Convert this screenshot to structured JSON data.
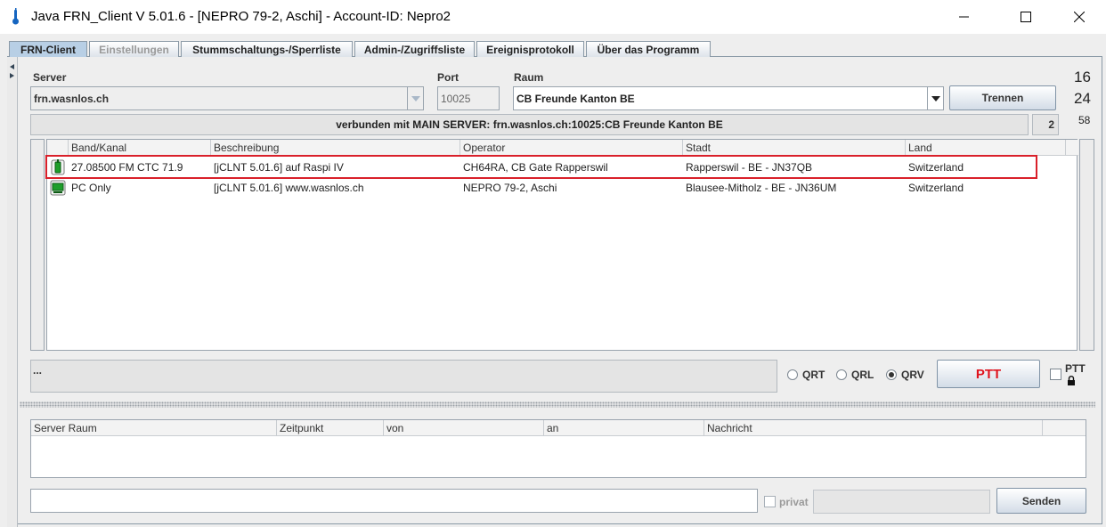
{
  "window": {
    "title": "Java FRN_Client V 5.01.6 - [NEPRO 79-2, Aschi] - Account-ID: Nepro2"
  },
  "tabs": [
    {
      "label": "FRN-Client",
      "state": "active"
    },
    {
      "label": "Einstellungen",
      "state": "disabled"
    },
    {
      "label": "Stummschaltungs-/Sperrliste",
      "state": "normal"
    },
    {
      "label": "Admin-/Zugriffsliste",
      "state": "normal"
    },
    {
      "label": "Ereignisprotokoll",
      "state": "normal"
    },
    {
      "label": "Über das Programm",
      "state": "normal"
    }
  ],
  "connection": {
    "server_label": "Server",
    "server_value": "frn.wasnlos.ch",
    "port_label": "Port",
    "port_value": "10025",
    "room_label": "Raum",
    "room_value": "CB Freunde Kanton BE",
    "disconnect_button": "Trennen",
    "status_text": "verbunden mit  MAIN SERVER: frn.wasnlos.ch:10025:CB Freunde Kanton BE",
    "counters": [
      "16",
      "24",
      "58"
    ],
    "user_count": "2"
  },
  "clients_table": {
    "headers": [
      "Band/Kanal",
      "Beschreibung",
      "Operator",
      "Stadt",
      "Land"
    ],
    "rows": [
      {
        "icon": "gateway-tx-icon",
        "band": "27.08500 FM CTC 71.9",
        "description": "[jCLNT 5.01.6] auf Raspi IV",
        "operator": "CH64RA, CB Gate Rapperswil",
        "city": "Rapperswil - BE - JN37QB",
        "country": "Switzerland",
        "highlighted": true
      },
      {
        "icon": "pc-client-icon",
        "band": "PC Only",
        "description": "[jCLNT 5.01.6] www.wasnlos.ch",
        "operator": "NEPRO 79-2, Aschi",
        "city": "Blausee-Mitholz - BE - JN36UM",
        "country": "Switzerland",
        "highlighted": false
      }
    ]
  },
  "status_box": {
    "text": "..."
  },
  "mode": {
    "options": [
      "QRT",
      "QRL",
      "QRV"
    ],
    "selected": "QRV",
    "ptt_button": "PTT",
    "ptt_lock_label": "PTT"
  },
  "messages_table": {
    "headers": [
      "Server Raum",
      "Zeitpunkt",
      "von",
      "an",
      "Nachricht"
    ]
  },
  "message_input": {
    "value": "",
    "private_label": "privat",
    "send_button": "Senden"
  },
  "colors": {
    "highlight_border": "#d9202a",
    "ptt_text": "#e0141e",
    "active_tab": "#b8cfe5"
  }
}
